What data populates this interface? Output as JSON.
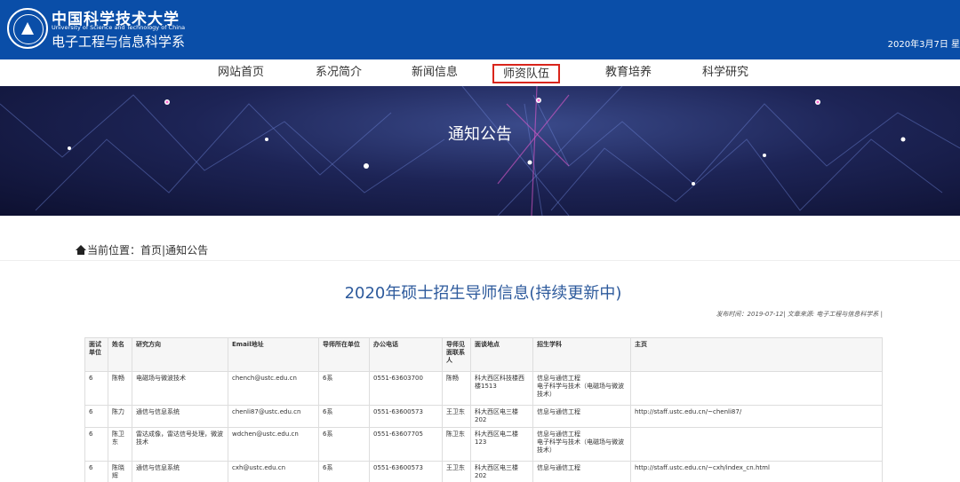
{
  "header": {
    "university_cn": "中国科学技术大学",
    "university_en": "University of Science and Technology of China",
    "department": "电子工程与信息科学系",
    "date": "2020年3月7日 星"
  },
  "nav": {
    "items": [
      {
        "label": "网站首页"
      },
      {
        "label": "系况简介"
      },
      {
        "label": "新闻信息"
      },
      {
        "label": "师资队伍"
      },
      {
        "label": "教育培养"
      },
      {
        "label": "科学研究"
      }
    ],
    "active": "师资队伍"
  },
  "banner": {
    "title": "通知公告"
  },
  "breadcrumb": {
    "prefix": "当前位置：",
    "home": "首页",
    "sep": "|",
    "current": "通知公告"
  },
  "article": {
    "title": "2020年硕士招生导师信息(持续更新中)",
    "meta": "发布时间：2019-07-12| 文章来源: 电子工程与信息科学系 |"
  },
  "table": {
    "headers": [
      "面试单位",
      "姓名",
      "研究方向",
      "Email地址",
      "导师所在单位",
      "办公电话",
      "导师见面联系人",
      "面谈地点",
      "招生学科",
      "主页"
    ],
    "rows": [
      [
        "6",
        "陈畅",
        "电磁场与微波技术",
        "chench@ustc.edu.cn",
        "6系",
        "0551-63603700",
        "陈畅",
        "科大西区科技楼西楼1513",
        "信息与通信工程\n电子科学与技术（电磁场与微波技术）",
        ""
      ],
      [
        "6",
        "陈力",
        "通信与信息系统",
        "chenli87@ustc.edu.cn",
        "6系",
        "0551-63600573",
        "王卫东",
        "科大西区电三楼202",
        "信息与通信工程",
        "http://staff.ustc.edu.cn/~chenli87/"
      ],
      [
        "6",
        "陈卫东",
        "雷达成像，雷达信号处理，微波技术",
        "wdchen@ustc.edu.cn",
        "6系",
        "0551-63607705",
        "陈卫东",
        "科大西区电二楼123",
        "信息与通信工程\n电子科学与技术（电磁场与微波技术）",
        ""
      ],
      [
        "6",
        "陈晓辉",
        "通信与信息系统",
        "cxh@ustc.edu.cn",
        "6系",
        "0551-63600573",
        "王卫东",
        "科大西区电三楼202",
        "信息与通信工程",
        "http://staff.ustc.edu.cn/~cxh/index_cn.html"
      ]
    ]
  }
}
